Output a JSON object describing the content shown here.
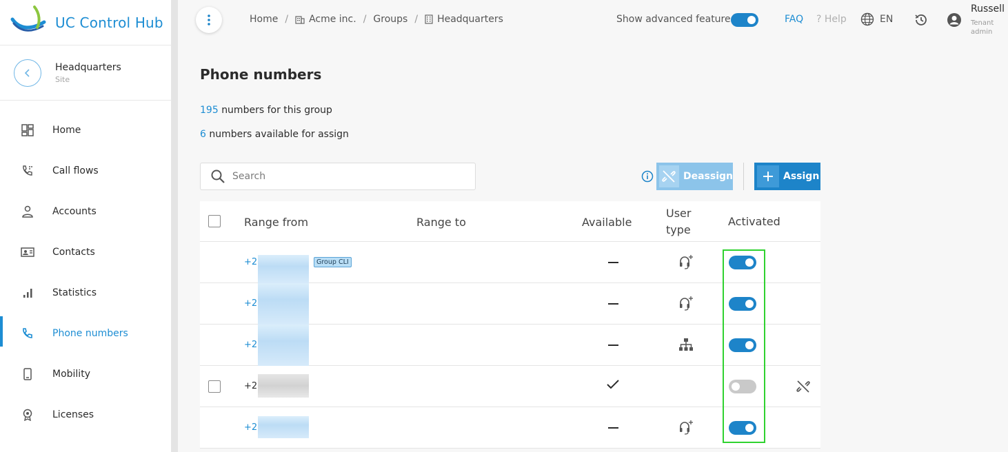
{
  "app": {
    "title": "UC Control Hub"
  },
  "site": {
    "title": "Headquarters",
    "subtitle": "Site"
  },
  "sidebar": {
    "items": [
      {
        "label": "Home",
        "icon": "dashboard-icon"
      },
      {
        "label": "Call flows",
        "icon": "call-flow-icon"
      },
      {
        "label": "Accounts",
        "icon": "person-icon"
      },
      {
        "label": "Contacts",
        "icon": "contact-card-icon"
      },
      {
        "label": "Statistics",
        "icon": "bar-chart-icon"
      },
      {
        "label": "Phone numbers",
        "icon": "phone-icon",
        "active": true
      },
      {
        "label": "Mobility",
        "icon": "mobile-icon"
      },
      {
        "label": "Licenses",
        "icon": "badge-icon"
      }
    ]
  },
  "breadcrumb": [
    "Home",
    "Acme inc.",
    "Groups",
    "Headquarters"
  ],
  "topbar": {
    "advanced_label": "Show advanced features",
    "advanced_on": true,
    "faq": "FAQ",
    "help": "? Help",
    "language": "EN",
    "user_name": "Russell N",
    "user_role_1": "Tenant",
    "user_role_2": "admin"
  },
  "page": {
    "title": "Phone numbers",
    "group_count": "195",
    "group_count_text": "numbers for this group",
    "available_count": "6",
    "available_text": "numbers available for assign",
    "search_placeholder": "Search",
    "deassign_label": "Deassign",
    "assign_label": "Assign"
  },
  "table": {
    "columns": {
      "range_from": "Range from",
      "range_to": "Range to",
      "available": "Available",
      "user_type_1": "User",
      "user_type_2": "type",
      "activated": "Activated"
    },
    "rows": [
      {
        "number": "+27",
        "badge": "Group CLI",
        "available": false,
        "user_type": "headset-add-icon",
        "activated": true,
        "selectable": false
      },
      {
        "number": "+27",
        "badge": "",
        "available": false,
        "user_type": "headset-add-icon",
        "activated": true,
        "selectable": false
      },
      {
        "number": "+27",
        "badge": "",
        "available": false,
        "user_type": "org-hierarchy-icon",
        "activated": true,
        "selectable": false
      },
      {
        "number": "+27",
        "badge": "",
        "available": true,
        "user_type": "",
        "activated": false,
        "selectable": true
      },
      {
        "number": "+27",
        "badge": "",
        "available": false,
        "user_type": "headset-add-icon",
        "activated": true,
        "selectable": false
      }
    ]
  },
  "colors": {
    "accent": "#1d84c9",
    "link": "#1d8dd3",
    "highlight": "#2fd22f"
  }
}
